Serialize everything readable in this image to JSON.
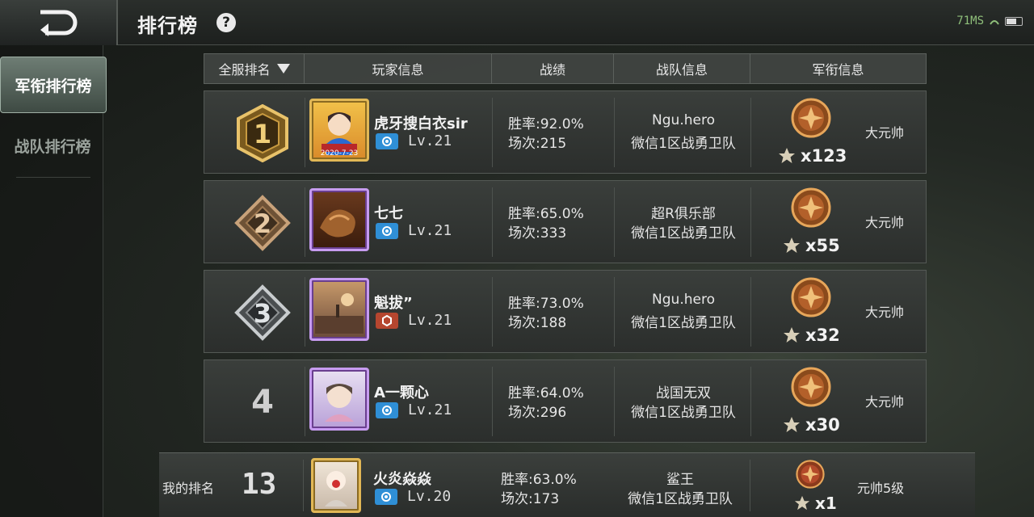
{
  "status": {
    "signal": "71MS"
  },
  "header": {
    "title": "排行榜",
    "help": "?"
  },
  "sidebar": {
    "items": [
      {
        "label": "军衔排行榜"
      },
      {
        "label": "战队排行榜"
      }
    ]
  },
  "columns": {
    "rank": "全服排名",
    "player": "玩家信息",
    "record": "战绩",
    "team": "战队信息",
    "mil": "军衔信息"
  },
  "rows": [
    {
      "rank": "1",
      "name": "虎牙搜白衣sir",
      "level": "Lv.21",
      "avatar_date": "2020-7-23",
      "win": "胜率:92.0%",
      "matches": "场次:215",
      "team": "Ngu.hero",
      "server": "微信1区战勇卫队",
      "stars": "x123",
      "mil_rank": "大元帅"
    },
    {
      "rank": "2",
      "name": "七七",
      "level": "Lv.21",
      "win": "胜率:65.0%",
      "matches": "场次:333",
      "team": "超R俱乐部",
      "server": "微信1区战勇卫队",
      "stars": "x55",
      "mil_rank": "大元帅"
    },
    {
      "rank": "3",
      "name": "魁拔”",
      "level": "Lv.21",
      "win": "胜率:73.0%",
      "matches": "场次:188",
      "team": "Ngu.hero",
      "server": "微信1区战勇卫队",
      "stars": "x32",
      "mil_rank": "大元帅"
    },
    {
      "rank": "4",
      "name": "A一颗心",
      "level": "Lv.21",
      "win": "胜率:64.0%",
      "matches": "场次:296",
      "team": "战国无双",
      "server": "微信1区战勇卫队",
      "stars": "x30",
      "mil_rank": "大元帅"
    }
  ],
  "me": {
    "label": "我的排名",
    "rank": "13",
    "name": "火炎焱焱",
    "level": "Lv.20",
    "win": "胜率:63.0%",
    "matches": "场次:173",
    "team": "鲨王",
    "server": "微信1区战勇卫队",
    "stars": "x1",
    "mil_rank": "元帅5级"
  },
  "colors": {
    "gold": "#e2b856",
    "purple": "#c79cf0",
    "blue_icon": "#2f8fd6",
    "red_icon": "#b5462f"
  }
}
